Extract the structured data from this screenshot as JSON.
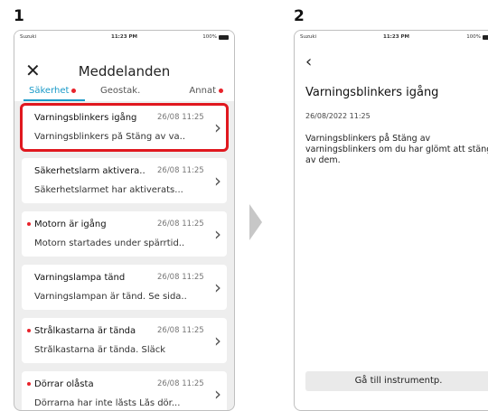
{
  "steps": {
    "one": "1",
    "two": "2"
  },
  "status": {
    "carrier": "Suzuki",
    "time": "11:23 PM",
    "battery": "100%"
  },
  "screen1": {
    "close_glyph": "✕",
    "title": "Meddelanden",
    "tabs": [
      {
        "label": "Säkerhet",
        "alert": true,
        "active": true
      },
      {
        "label": "Geostak.",
        "alert": false,
        "active": false
      },
      {
        "label": "Annat",
        "alert": true,
        "active": false
      }
    ],
    "messages": [
      {
        "title": "Varningsblinkers igång",
        "date": "26/08 11:25",
        "preview": "Varningsblinkers på Stäng av va..",
        "unread": false,
        "selected": true
      },
      {
        "title": "Säkerhetslarm aktivera..",
        "date": "26/08 11:25",
        "preview": "Säkerhetslarmet har aktiverats...",
        "unread": false,
        "selected": false
      },
      {
        "title": "Motorn är igång",
        "date": "26/08 11:25",
        "preview": "Motorn startades under spärrtid..",
        "unread": true,
        "selected": false
      },
      {
        "title": "Varningslampa tänd",
        "date": "26/08 11:25",
        "preview": "Varningslampan är tänd. Se sida..",
        "unread": false,
        "selected": false
      },
      {
        "title": "Strålkastarna är tända",
        "date": "26/08 11:25",
        "preview": "Strålkastarna är tända. Släck",
        "unread": true,
        "selected": false
      },
      {
        "title": "Dörrar olåsta",
        "date": "26/08 11:25",
        "preview": "Dörrarna har inte låsts Lås dör...",
        "unread": true,
        "selected": false
      }
    ]
  },
  "screen2": {
    "back_glyph": "‹",
    "title": "Varningsblinkers igång",
    "date": "26/08/2022 11:25",
    "body": "Varningsblinkers på Stäng av varningsblinkers om du har glömt att stänga av dem.",
    "button_label": "Gå till instrumentp."
  },
  "colors": {
    "accent": "#1a9ac8",
    "alert": "#e8232b",
    "highlight": "#e0181f"
  }
}
